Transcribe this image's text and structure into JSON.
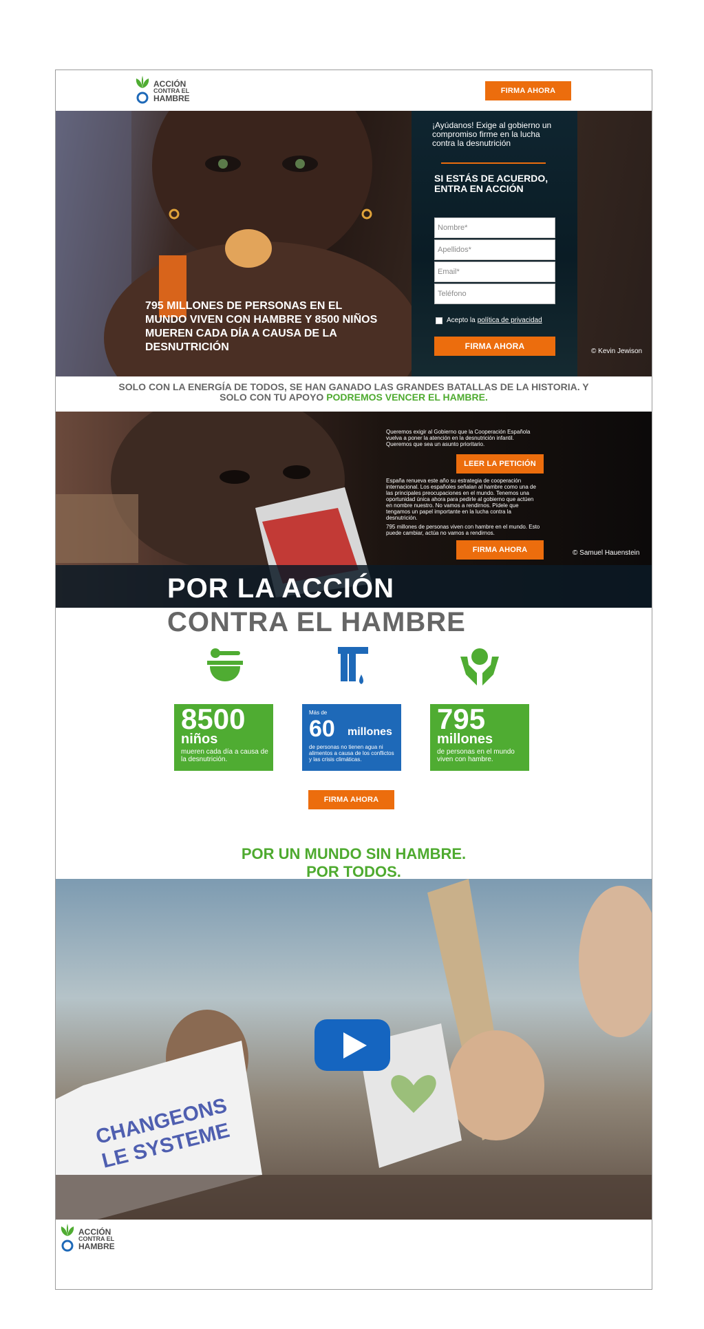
{
  "header": {
    "logo": {
      "line1": "ACCIÓN",
      "line2": "CONTRA EL",
      "line3": "HAMBRE"
    },
    "cta_label": "FIRMA AHORA"
  },
  "hero": {
    "caption": "795 MILLONES DE PERSONAS EN EL MUNDO VIVEN CON HAMBRE Y 8500 NIÑOS MUEREN CADA DÍA A CAUSA DE LA DESNUTRICIÓN",
    "credit": "© Kevin Jewison",
    "form": {
      "intro": "¡Ayúdanos! Exige al gobierno un compromiso firme en la lucha contra la desnutrición",
      "title": "SI ESTÁS DE ACUERDO, ENTRA EN ACCIÓN",
      "fields": {
        "nombre": "Nombre*",
        "apellidos": "Apellidos*",
        "email": "Email*",
        "telefono": "Teléfono"
      },
      "privacy_prefix": "Acepto la",
      "privacy_link": "política de privacidad",
      "submit_label": "FIRMA AHORA"
    }
  },
  "tagline": {
    "text": "SOLO CON LA ENERGÍA DE TODOS, SE HAN GANADO LAS GRANDES BATALLAS DE LA HISTORIA. Y SOLO CON TU APOYO",
    "highlight": "PODREMOS VENCER EL HAMBRE."
  },
  "petition": {
    "paragraph1": "Queremos exigir al Gobierno que la Cooperación Española vuelva a poner la atención en la desnutrición infantil. Queremos que sea un asunto prioritario.",
    "read_label": "LEER LA PETICIÓN",
    "paragraph2": "España renueva este año su estrategia de cooperación internacional. Los españoles señalan al hambre como una de las principales preocupaciones en el mundo. Tenemos una oportunidad única ahora para pedirle al gobierno que actúen en nombre nuestro. No vamos a rendirnos. Pídele que tengamos un papel importante en la lucha contra la desnutrición.",
    "paragraph3": "795 millones de personas viven con hambre en el mundo. Esto puede cambiar, actúa no vamos a rendirnos.",
    "cta_label": "FIRMA AHORA",
    "credit": "© Samuel Hauenstein"
  },
  "headline": {
    "line1": "POR LA ACCIÓN",
    "line2": "CONTRA EL HAMBRE"
  },
  "stats": [
    {
      "number": "8500",
      "unit": "niños",
      "desc": "mueren cada día a causa de la desnutrición."
    },
    {
      "prefix": "Más de",
      "number": "60",
      "unit": "millones",
      "desc": "de personas no tienen agua ni alimentos a causa de los conflictos y las crisis climáticas."
    },
    {
      "number": "795",
      "unit": "millones",
      "desc": "de personas en el mundo viven con hambre."
    }
  ],
  "stats_cta_label": "FIRMA AHORA",
  "claim": {
    "line1": "POR UN MUNDO SIN HAMBRE.",
    "line2": "POR TODOS."
  },
  "video": {
    "sign_text": "CHANGEONS LE SYSTEME"
  },
  "footer": {
    "logo": {
      "line1": "ACCIÓN",
      "line2": "CONTRA EL",
      "line3": "HAMBRE"
    }
  },
  "colors": {
    "orange": "#ec6d0d",
    "green": "#4fac32",
    "blue": "#1e69b8",
    "grey_text": "#666666"
  }
}
